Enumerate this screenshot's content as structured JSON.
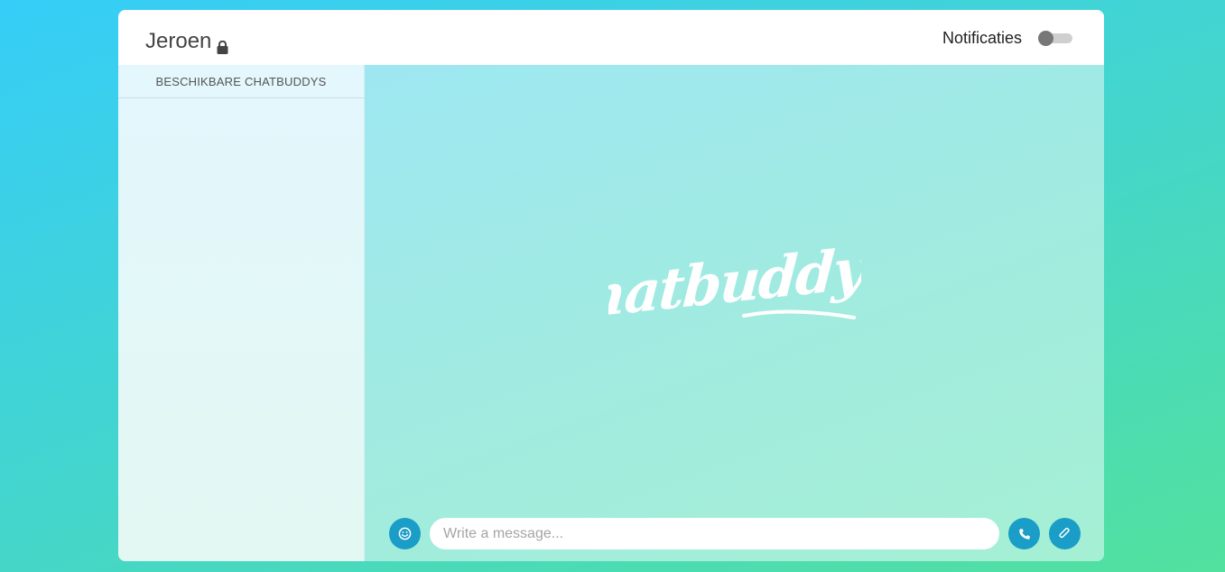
{
  "header": {
    "username": "Jeroen",
    "lock_icon": "lock-icon",
    "notifications_label": "Notificaties",
    "notifications_enabled": false
  },
  "sidebar": {
    "title": "BESCHIKBARE CHATBUDDYS",
    "items": []
  },
  "main": {
    "logo_text": "Chatbuddy's",
    "composer": {
      "placeholder": "Write a message...",
      "value": "",
      "emoji_icon": "smiley-icon",
      "call_icon": "phone-icon",
      "attach_icon": "paperclip-icon"
    }
  },
  "colors": {
    "accent": "#1a9dc6",
    "background_start": "#36cdf8",
    "background_end": "#52e19e"
  }
}
